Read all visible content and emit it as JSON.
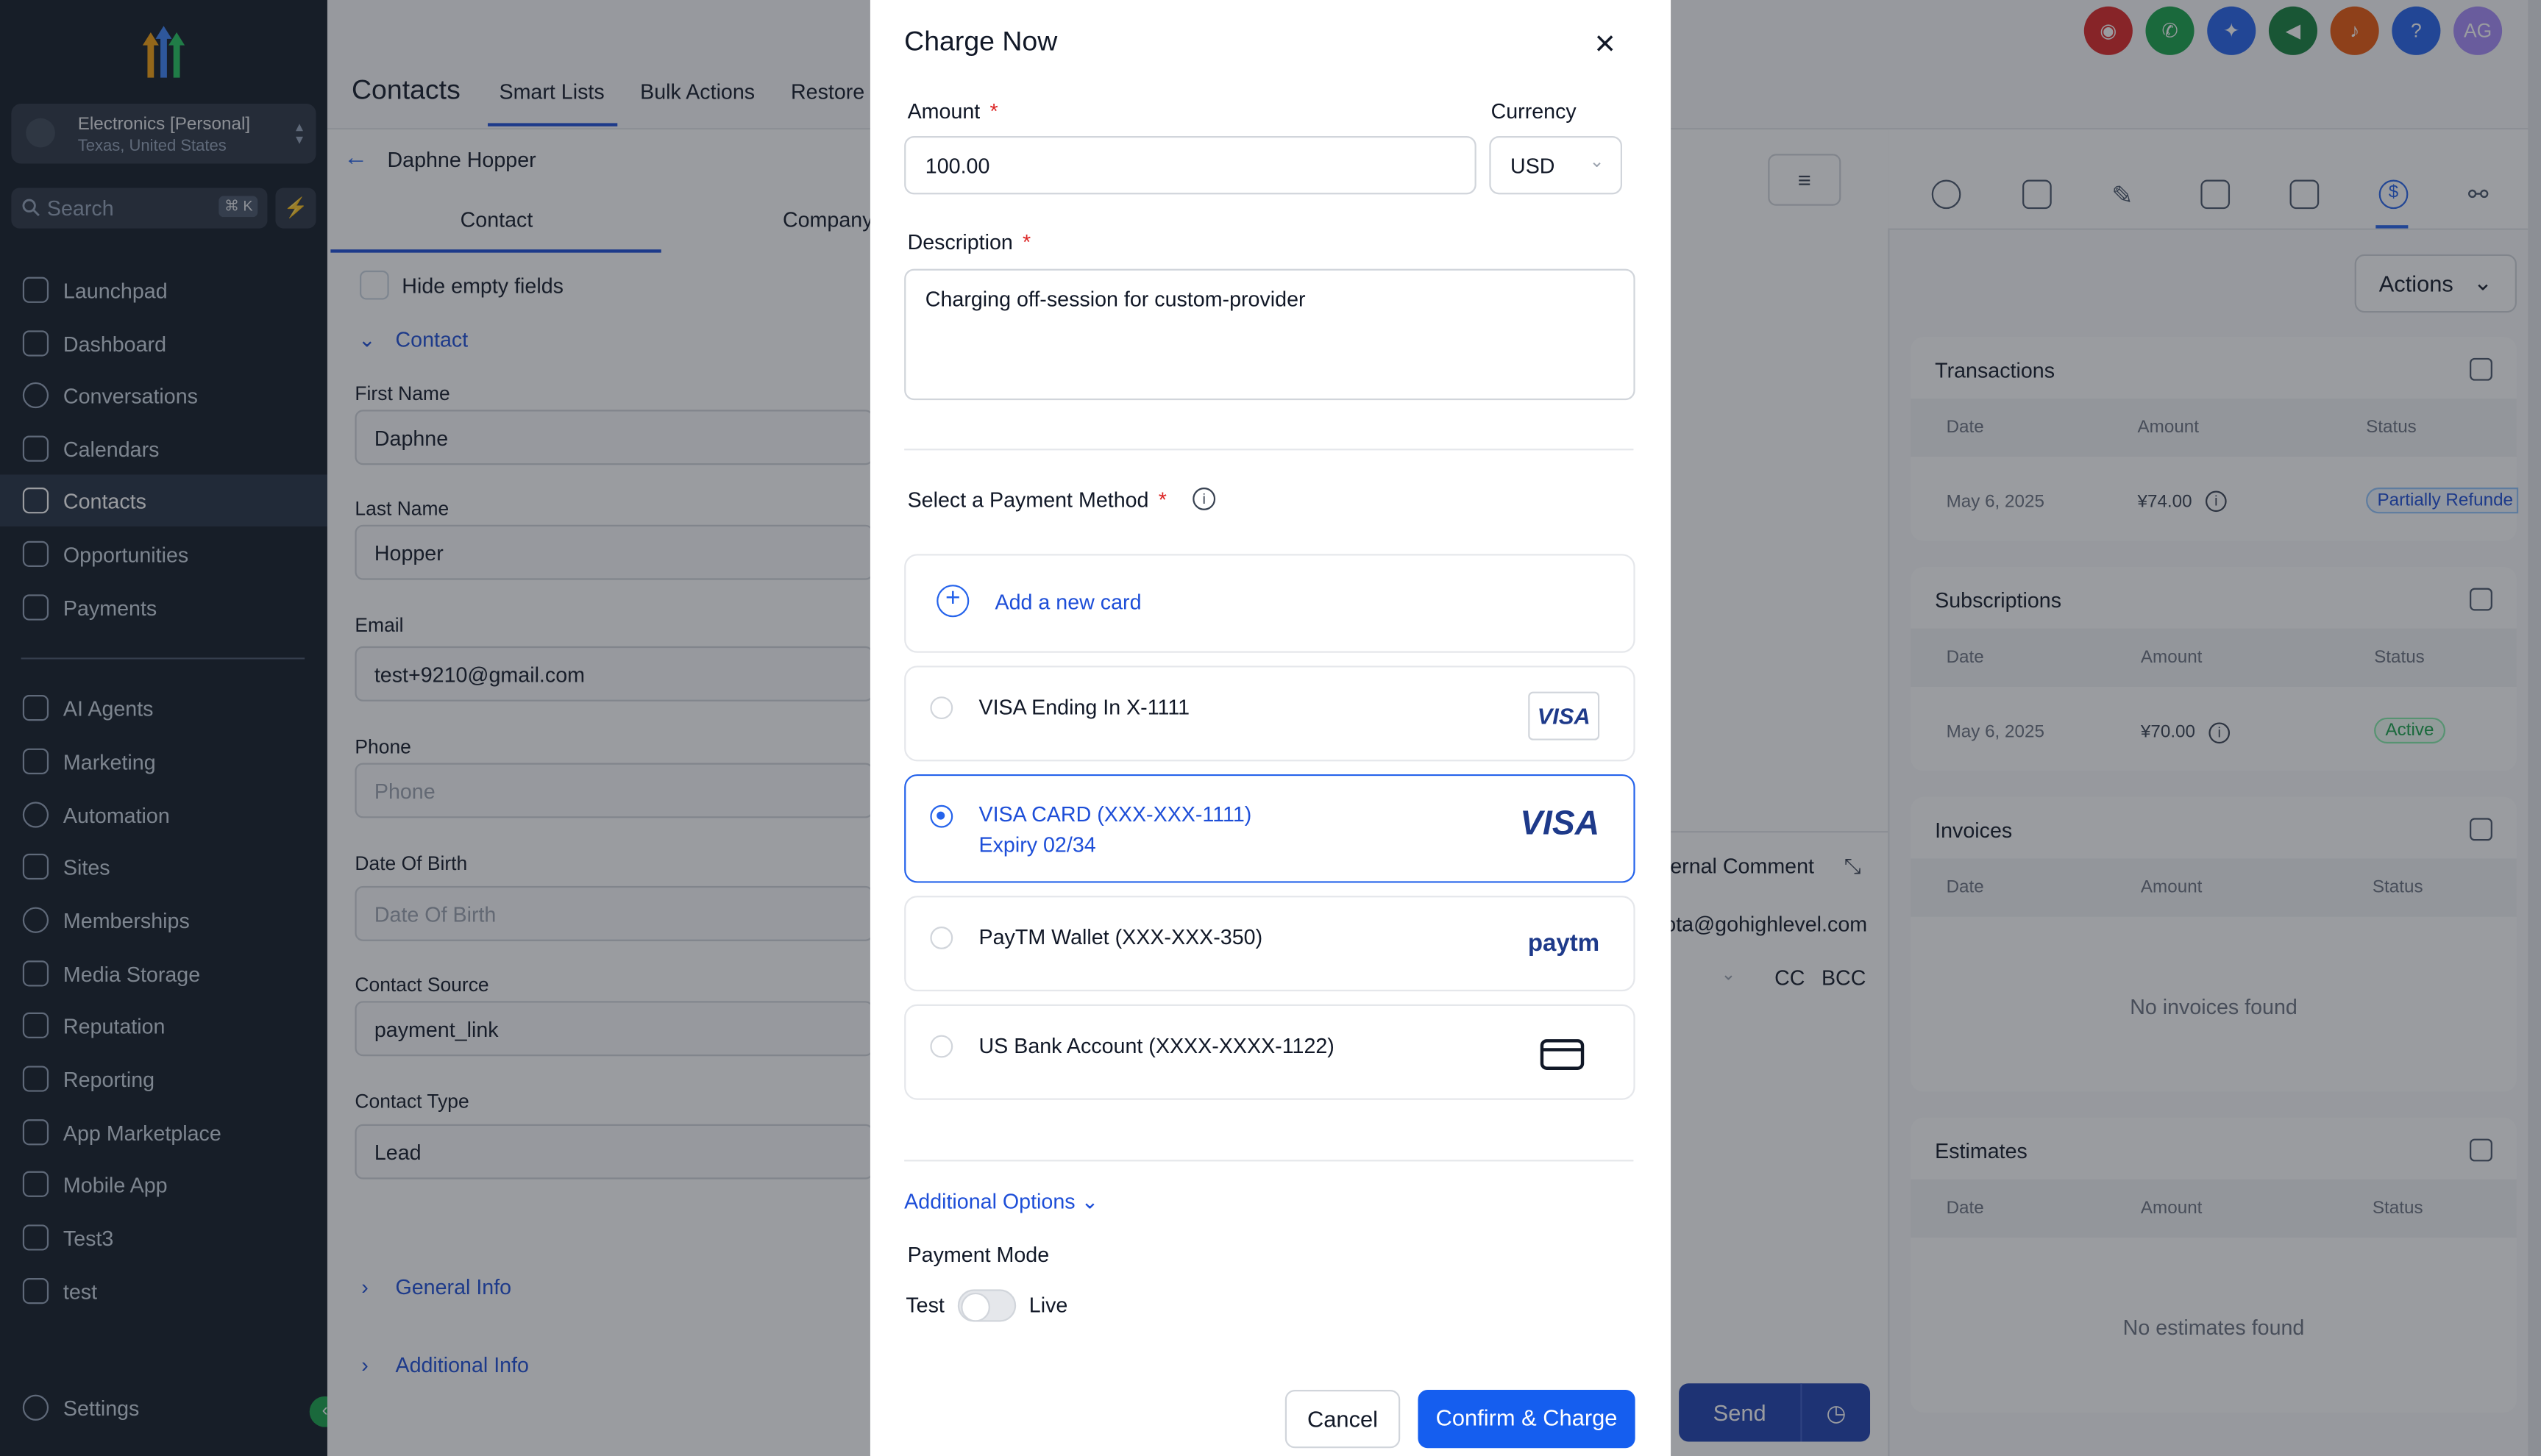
{
  "sidebar": {
    "account_name": "Electronics [Personal]",
    "account_location": "Texas, United States",
    "search_placeholder": "Search",
    "search_shortcut": "⌘ K",
    "items": [
      {
        "label": "Launchpad",
        "icon": "rocket-icon"
      },
      {
        "label": "Dashboard",
        "icon": "grid-icon"
      },
      {
        "label": "Conversations",
        "icon": "chat-icon"
      },
      {
        "label": "Calendars",
        "icon": "calendar-icon"
      },
      {
        "label": "Contacts",
        "icon": "contacts-icon"
      },
      {
        "label": "Opportunities",
        "icon": "opportunities-icon"
      },
      {
        "label": "Payments",
        "icon": "payments-icon"
      },
      {
        "label": "AI Agents",
        "icon": "sparkle-icon"
      },
      {
        "label": "Marketing",
        "icon": "send-icon"
      },
      {
        "label": "Automation",
        "icon": "automation-icon"
      },
      {
        "label": "Sites",
        "icon": "sites-icon"
      },
      {
        "label": "Memberships",
        "icon": "memberships-icon"
      },
      {
        "label": "Media Storage",
        "icon": "media-icon"
      },
      {
        "label": "Reputation",
        "icon": "star-icon"
      },
      {
        "label": "Reporting",
        "icon": "chart-icon"
      },
      {
        "label": "App Marketplace",
        "icon": "apps-icon"
      },
      {
        "label": "Mobile App",
        "icon": "mobile-icon"
      },
      {
        "label": "Test3",
        "icon": "custom-icon"
      },
      {
        "label": "test",
        "icon": "custom-icon"
      }
    ],
    "settings_label": "Settings"
  },
  "header": {
    "title": "Contacts",
    "tabs": [
      "Smart Lists",
      "Bulk Actions",
      "Restore"
    ],
    "avatar_initials": "AG"
  },
  "contact": {
    "name": "Daphne Hopper",
    "subtabs": [
      "Contact",
      "Company"
    ],
    "hide_empty_label": "Hide empty fields",
    "section_label": "Contact",
    "fields": [
      {
        "label": "First Name",
        "value": "Daphne",
        "placeholder": ""
      },
      {
        "label": "Last Name",
        "value": "Hopper",
        "placeholder": ""
      },
      {
        "label": "Email",
        "value": "test+9210@gmail.com",
        "placeholder": ""
      },
      {
        "label": "Phone",
        "value": "",
        "placeholder": "Phone"
      },
      {
        "label": "Date Of Birth",
        "value": "",
        "placeholder": "Date Of Birth"
      },
      {
        "label": "Contact Source",
        "value": "payment_link",
        "placeholder": ""
      },
      {
        "label": "Contact Type",
        "value": "Lead",
        "placeholder": ""
      }
    ],
    "general_info": "General Info",
    "additional_info": "Additional Info"
  },
  "middle": {
    "internal_comment": "ternal Comment",
    "email_partial": "ota@gohighlevel.com",
    "cc": "CC",
    "bcc": "BCC",
    "send": "Send"
  },
  "right": {
    "actions_label": "Actions",
    "transactions": {
      "title": "Transactions",
      "columns": [
        "Date",
        "Amount",
        "Status"
      ],
      "rows": [
        {
          "date": "May 6, 2025",
          "amount": "¥74.00",
          "status": "Partially Refunde"
        }
      ]
    },
    "subscriptions": {
      "title": "Subscriptions",
      "columns": [
        "Date",
        "Amount",
        "Status"
      ],
      "rows": [
        {
          "date": "May 6, 2025",
          "amount": "¥70.00",
          "status": "Active"
        }
      ]
    },
    "invoices": {
      "title": "Invoices",
      "columns": [
        "Date",
        "Amount",
        "Status"
      ],
      "empty": "No invoices found"
    },
    "estimates": {
      "title": "Estimates",
      "columns": [
        "Date",
        "Amount",
        "Status"
      ],
      "empty": "No estimates found"
    }
  },
  "modal": {
    "title": "Charge Now",
    "amount_label": "Amount",
    "amount_value": "100.00",
    "currency_label": "Currency",
    "currency_value": "USD",
    "description_label": "Description",
    "description_value": "Charging off-session for custom-provider",
    "payment_method_label": "Select a Payment Method",
    "add_card_label": "Add a new card",
    "methods": [
      {
        "line1": "VISA Ending In X-1111",
        "line2": "",
        "brand": "VISA",
        "selected": false
      },
      {
        "line1": "VISA CARD (XXX-XXX-1111)",
        "line2": "Expiry 02/34",
        "brand": "VISA",
        "selected": true
      },
      {
        "line1": "PayTM Wallet (XXX-XXX-350)",
        "line2": "",
        "brand": "paytm",
        "selected": false
      },
      {
        "line1": "US Bank Account (XXXX-XXXX-1122)",
        "line2": "",
        "brand": "card-icon",
        "selected": false
      }
    ],
    "additional_options": "Additional Options",
    "payment_mode_label": "Payment Mode",
    "mode_test": "Test",
    "mode_live": "Live",
    "cancel": "Cancel",
    "confirm": "Confirm & Charge"
  },
  "colors": {
    "accent": "#1d4ed8",
    "sidebar_bg": "#121a26",
    "primary_button": "#1d4ed8"
  }
}
